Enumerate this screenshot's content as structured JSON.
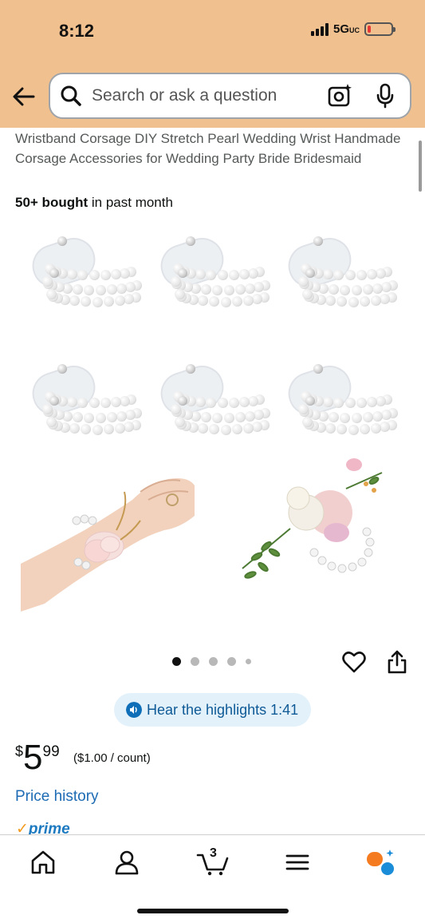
{
  "status_bar": {
    "time": "8:12",
    "network": "5G",
    "network_suffix": "UC",
    "battery_level": 0.15,
    "battery_color": "#e53935"
  },
  "search": {
    "placeholder": "Search or ask a question",
    "icons": [
      "back-arrow-icon",
      "search-icon",
      "camera-lens-icon",
      "microphone-icon"
    ]
  },
  "product": {
    "title": "Wristband Corsage DIY Stretch Pearl Wedding Wrist Handmade Corsage Accessories for Wedding Party Bride Bridesmaid",
    "bought_count": "50+ bought",
    "bought_suffix": " in past month",
    "price_currency": "$",
    "price_whole": "5",
    "price_cents": "99",
    "price_per_count": "($1.00 / count)",
    "price_history_label": "Price history",
    "prime_label": "prime"
  },
  "gallery": {
    "image_count": 5,
    "active_index": 0
  },
  "highlights": {
    "label": "Hear the highlights 1:41"
  },
  "nav": {
    "cart_count": "3",
    "items": [
      "home-icon",
      "account-icon",
      "cart-icon",
      "menu-icon",
      "rufus-icon"
    ]
  },
  "colors": {
    "header_bg": "#f0c08e",
    "link": "#1d6bb4",
    "highlight_bg": "#e3f1fb",
    "rufus_orange": "#f47b20",
    "rufus_blue": "#1a8cd8"
  }
}
